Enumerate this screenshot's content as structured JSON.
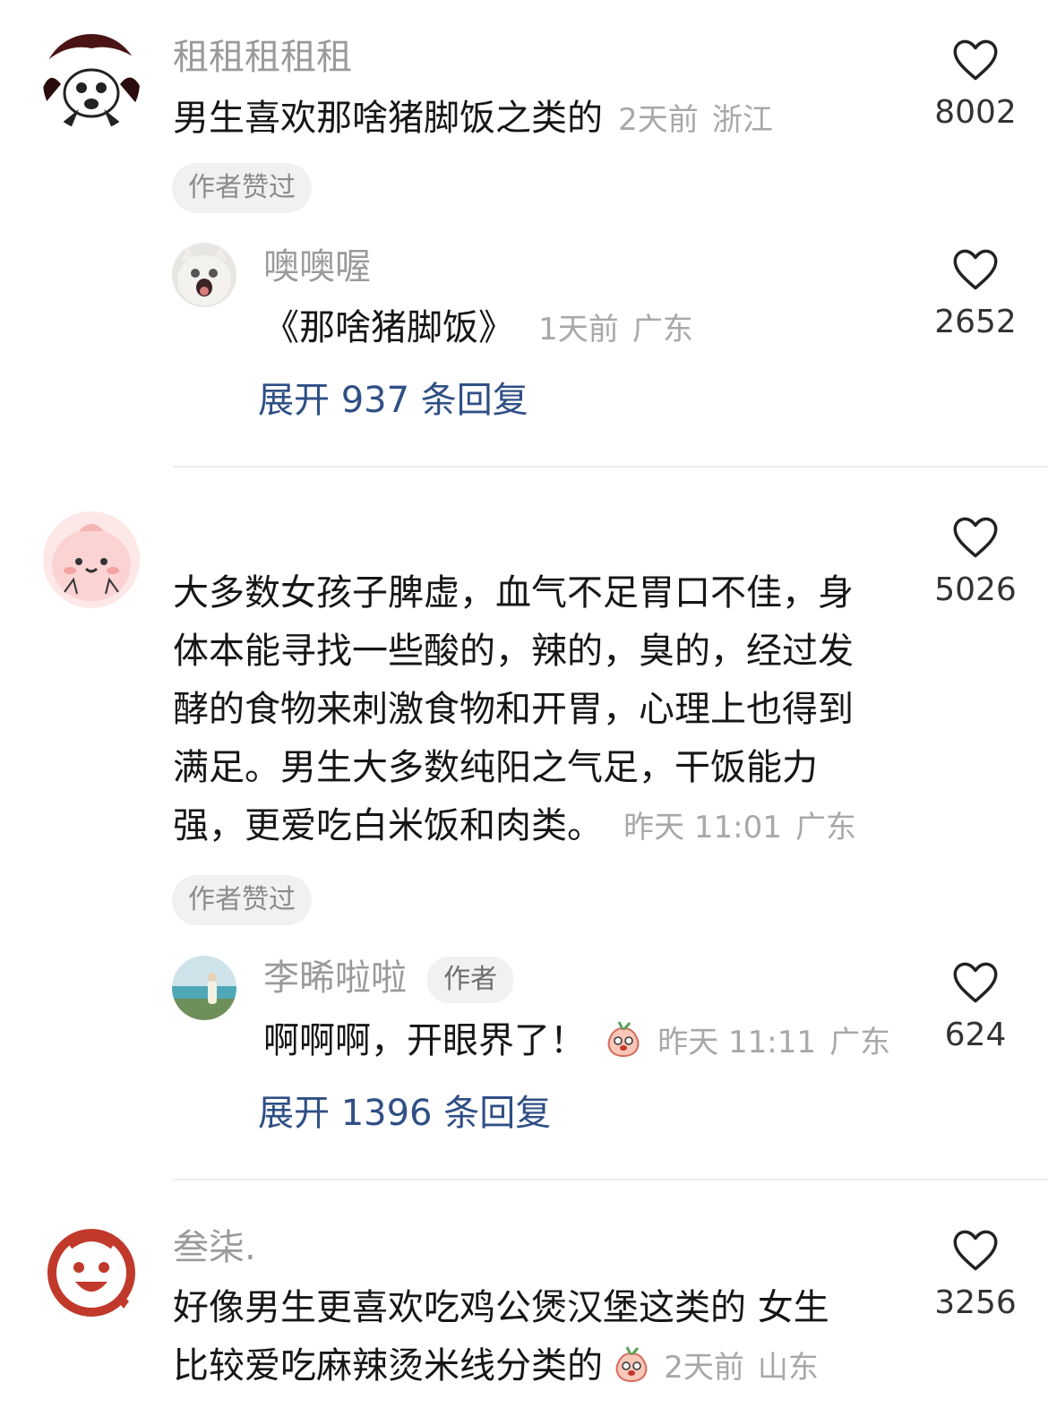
{
  "colors": {
    "link": "#2f4f85",
    "meta": "#a8a8a8",
    "tag_bg": "#f1f1f1"
  },
  "comments": [
    {
      "username": "租租租租租",
      "text": "男生喜欢那啥猪脚饭之类的",
      "time": "2天前",
      "location": "浙江",
      "tag": "作者赞过",
      "likes": "8002",
      "replies": [
        {
          "username": "噢噢喔",
          "text": "《那啥猪脚饭》",
          "time": "1天前",
          "location": "广东",
          "likes": "2652"
        }
      ],
      "expand_label": "展开 937 条回复"
    },
    {
      "username": "",
      "text_lines": [
        "大多数女孩子脾虚，血气不足胃口不佳，身",
        "体本能寻找一些酸的，辣的，臭的，经过发",
        "酵的食物来刺激食物和开胃，心理上也得到",
        "满足。男生大多数纯阳之气足，干饭能力",
        "强，更爱吃白米饭和肉类。"
      ],
      "time": "昨天 11:01",
      "location": "广东",
      "tag": "作者赞过",
      "likes": "5026",
      "replies": [
        {
          "username": "李晞啦啦",
          "author_badge": "作者",
          "text": "啊啊啊，开眼界了！",
          "emoji": "peach-emoji",
          "time": "昨天 11:11",
          "location": "广东",
          "likes": "624"
        }
      ],
      "expand_label": "展开 1396 条回复"
    },
    {
      "username": "叁柒.",
      "text_lines": [
        "好像男生更喜欢吃鸡公煲汉堡这类的 女生",
        "比较爱吃麻辣烫米线分类的"
      ],
      "emoji": "peach-emoji",
      "time": "2天前",
      "location": "山东",
      "likes": "3256"
    }
  ]
}
